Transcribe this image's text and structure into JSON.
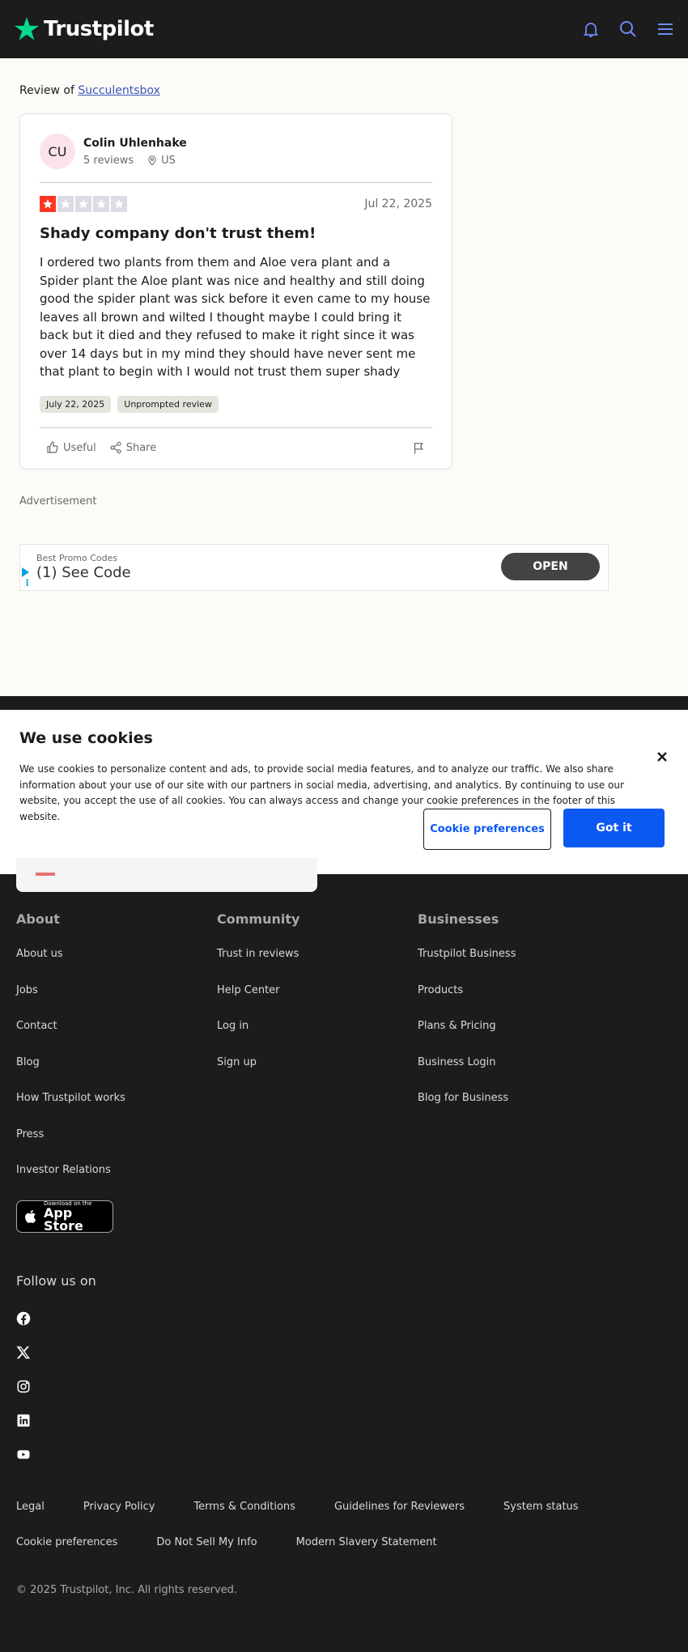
{
  "header": {
    "logo_text": "Trustpilot",
    "icons": [
      "bell-icon",
      "search-icon",
      "menu-icon"
    ],
    "accent_color": "#04da8d"
  },
  "review_of": {
    "prefix": "Review of ",
    "company": "Succulentsbox"
  },
  "review": {
    "initials": "CU",
    "name": "Colin Uhlenhake",
    "reviews_count": "5 reviews",
    "location": "US",
    "rating": 1,
    "max_rating": 5,
    "date": "Jul 22, 2025",
    "title": "Shady company don't trust them!",
    "body": "I ordered two plants from them and Aloe vera plant and a Spider plant the Aloe plant was nice and healthy and still doing good the spider plant was sick before it even came to my house leaves all brown and wilted I thought maybe I could bring it back but it died and they refused to make it right since it was over 14 days but in my mind they should have never sent me that plant to begin with I would not trust them super shady",
    "tag_date": "July 22, 2025",
    "tag_type": "Unprompted review",
    "useful_label": "Useful",
    "share_label": "Share"
  },
  "advertisement": {
    "label": "Advertisement",
    "small_text": "Best Promo Codes",
    "big_text": "(1) See Code",
    "button": "OPEN"
  },
  "cookie": {
    "title": "We use cookies",
    "text": "We use cookies to personalize content and ads, to provide social media features, and to analyze our traffic. We also share information about your use of our site with our partners in social media, advertising, and analytics. By continuing to use our website, you accept the use of all cookies. You can always access and change your cookie preferences in the footer of this website.",
    "preferences_button": "Cookie preferences",
    "accept_button": "Got it"
  },
  "footer": {
    "about": {
      "heading": "About",
      "links": [
        "About us",
        "Jobs",
        "Contact",
        "Blog",
        "How Trustpilot works",
        "Press",
        "Investor Relations"
      ]
    },
    "community": {
      "heading": "Community",
      "links": [
        "Trust in reviews",
        "Help Center",
        "Log in",
        "Sign up"
      ]
    },
    "businesses": {
      "heading": "Businesses",
      "links": [
        "Trustpilot Business",
        "Products",
        "Plans & Pricing",
        "Business Login",
        "Blog for Business"
      ]
    },
    "app_store_small": "Download on the",
    "app_store_big": "App Store",
    "follow_us": "Follow us on",
    "social": [
      "facebook-icon",
      "x-icon",
      "instagram-icon",
      "linkedin-icon",
      "youtube-icon"
    ],
    "legal_links_row1": [
      "Legal",
      "Privacy Policy",
      "Terms & Conditions",
      "Guidelines for Reviewers",
      "System status"
    ],
    "legal_links_row2": [
      "Cookie preferences",
      "Do Not Sell My Info",
      "Modern Slavery Statement"
    ],
    "copyright": "© 2025 Trustpilot, Inc. All rights reserved."
  }
}
